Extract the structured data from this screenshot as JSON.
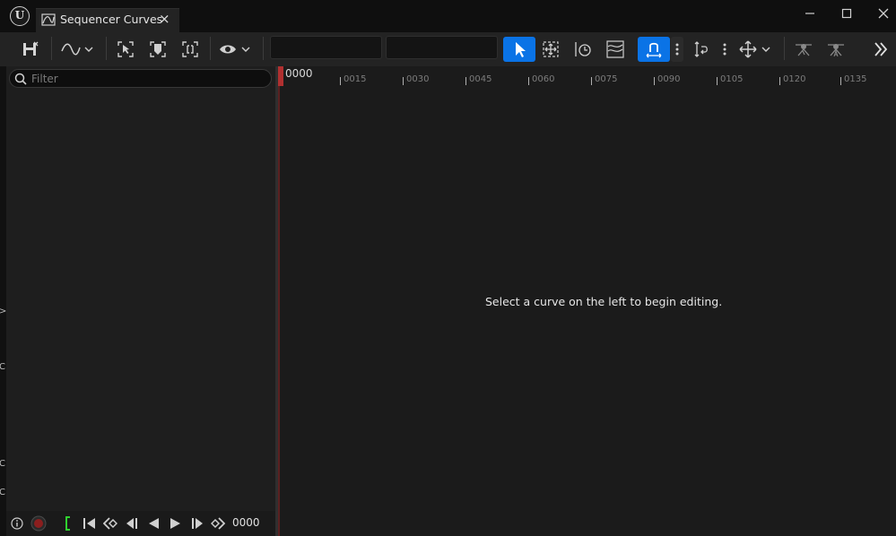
{
  "app": {
    "logo_icon": "unreal-logo-icon"
  },
  "tab": {
    "title": "Sequencer Curves",
    "close": "×",
    "icon": "curve-editor-icon"
  },
  "window": {
    "minimize_icon": "minimize-icon",
    "maximize_icon": "maximize-icon",
    "close_icon": "close-icon"
  },
  "toolbar": {
    "icons": [
      "save-icon",
      "curve-view-icon",
      "frame-selection-icon",
      "key-icon",
      "frame-all-icon",
      "eye-icon",
      "select-icon",
      "transform-icon",
      "retime-icon",
      "multi-scale-icon",
      "snap-icon",
      "kebab-icon",
      "normalize-icon",
      "kebab-icon",
      "move-icon",
      "tangent-icon",
      "tangent-auto-icon",
      "chevrons-right-icon"
    ],
    "field_1": "",
    "field_2": "",
    "accent_color": "#0a73e6"
  },
  "sidebar": {
    "filter_placeholder": "Filter",
    "edge_glyphs": [
      ">",
      "C",
      "C",
      "C"
    ]
  },
  "transport": {
    "frame": "0000",
    "icons": [
      "info-icon",
      "record-icon",
      "range-start-icon",
      "skip-to-start-icon",
      "prev-key-icon",
      "step-back-icon",
      "play-reverse-icon",
      "play-icon",
      "step-forward-icon",
      "next-key-icon"
    ]
  },
  "timeline": {
    "start_label": "0000",
    "ticks": [
      "0015",
      "0030",
      "0045",
      "0060",
      "0075",
      "0090",
      "0105",
      "0120",
      "0135"
    ],
    "playhead_color": "#b03030"
  },
  "editor": {
    "empty_message": "Select a curve on the left to begin editing."
  }
}
